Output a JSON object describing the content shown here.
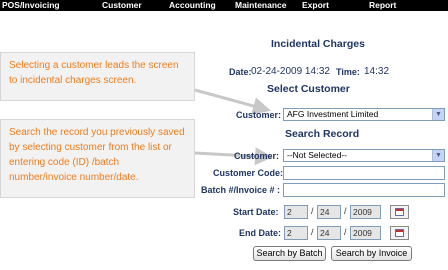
{
  "menu": [
    "POS/Invoicing",
    "Customer",
    "Accounting",
    "Maintenance",
    "Export",
    "Report"
  ],
  "page_title": "Incidental Charges",
  "date_line": {
    "date_label": "Date:",
    "date_value": "02-24-2009 14:32",
    "time_label": "Time:",
    "time_value": "14:32"
  },
  "select_customer": {
    "heading": "Select Customer",
    "label": "Customer:",
    "value": "AFG Investment Limited"
  },
  "search_record": {
    "heading": "Search Record",
    "customer_label": "Customer:",
    "customer_value": "--Not Selected--",
    "code_label": "Customer Code:",
    "code_value": "",
    "batch_label": "Batch #/Invoice # :",
    "batch_value": "",
    "start_label": "Start Date:",
    "start": {
      "month": "2",
      "day": "24",
      "year": "2009"
    },
    "end_label": "End Date:",
    "end": {
      "month": "2",
      "day": "24",
      "year": "2009"
    },
    "date_sep": "/",
    "search_batch": "Search by Batch",
    "search_invoice": "Search by Invoice"
  },
  "callouts": {
    "first": "Selecting a customer leads the screen to incidental charges screen.",
    "second": "Search the record you previously saved by selecting customer from the list or entering code (ID) /batch number/invoice number/date."
  },
  "icons": {
    "dropdown": "chevron-down-icon",
    "calendar": "calendar-icon"
  },
  "colors": {
    "menu_bar": "#000000",
    "heading_text": "#1f3563",
    "callout_text": "#f07c1b",
    "callout_bg": "#f2f2f2"
  }
}
